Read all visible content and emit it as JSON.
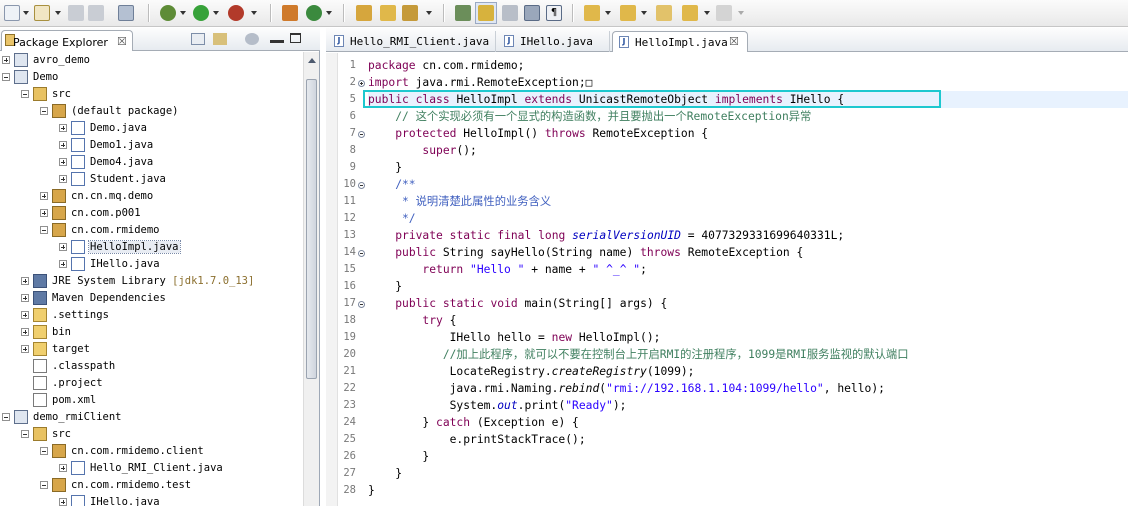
{
  "toolbar": {
    "icons": [
      "new-icon",
      "new-dropdown-icon",
      "save-icon",
      "save-all-icon",
      "print-icon",
      "debug-icon",
      "run-icon",
      "run-external-icon",
      "open-type-icon",
      "new-java-package-icon",
      "open-task-icon",
      "open-folder-icon",
      "search-icon",
      "toggle-mark-occurrences-icon",
      "toggle-highlight-icon",
      "show-whitespace-icon",
      "block-selection-icon",
      "pilcrow-icon",
      "next-annotation-icon",
      "previous-annotation-icon",
      "last-edit-location-icon",
      "back-icon",
      "forward-icon"
    ]
  },
  "package_explorer": {
    "title": "Package Explorer",
    "close_label": "☒",
    "tree": [
      {
        "label": "avro_demo",
        "level": 0,
        "expander": "plus",
        "icon": "java-project-icon"
      },
      {
        "label": "Demo",
        "level": 0,
        "expander": "minus",
        "icon": "java-project-icon"
      },
      {
        "label": "src",
        "level": 1,
        "expander": "minus",
        "icon": "source-folder-icon"
      },
      {
        "label": "(default package)",
        "level": 2,
        "expander": "minus",
        "icon": "package-icon"
      },
      {
        "label": "Demo.java",
        "level": 3,
        "expander": "plus",
        "icon": "java-file-icon"
      },
      {
        "label": "Demo1.java",
        "level": 3,
        "expander": "plus",
        "icon": "java-file-icon"
      },
      {
        "label": "Demo4.java",
        "level": 3,
        "expander": "plus",
        "icon": "java-file-icon"
      },
      {
        "label": "Student.java",
        "level": 3,
        "expander": "plus",
        "icon": "java-file-icon"
      },
      {
        "label": "cn.cn.mq.demo",
        "level": 2,
        "expander": "plus",
        "icon": "package-icon"
      },
      {
        "label": "cn.com.p001",
        "level": 2,
        "expander": "plus",
        "icon": "package-icon"
      },
      {
        "label": "cn.com.rmidemo",
        "level": 2,
        "expander": "minus",
        "icon": "package-icon"
      },
      {
        "label": "HelloImpl.java",
        "level": 3,
        "expander": "plus",
        "icon": "java-file-icon",
        "selected": true
      },
      {
        "label": "IHello.java",
        "level": 3,
        "expander": "plus",
        "icon": "java-file-icon"
      },
      {
        "label": "JRE System Library",
        "suffix": " [jdk1.7.0_13]",
        "level": 1,
        "expander": "plus",
        "icon": "library-icon"
      },
      {
        "label": "Maven Dependencies",
        "level": 1,
        "expander": "plus",
        "icon": "library-icon"
      },
      {
        "label": ".settings",
        "level": 1,
        "expander": "plus",
        "icon": "folder-icon"
      },
      {
        "label": "bin",
        "level": 1,
        "expander": "plus",
        "icon": "folder-icon"
      },
      {
        "label": "target",
        "level": 1,
        "expander": "plus",
        "icon": "folder-icon"
      },
      {
        "label": ".classpath",
        "level": 1,
        "expander": "none",
        "icon": "xml-file-icon"
      },
      {
        "label": ".project",
        "level": 1,
        "expander": "none",
        "icon": "xml-file-icon"
      },
      {
        "label": "pom.xml",
        "level": 1,
        "expander": "none",
        "icon": "maven-file-icon"
      },
      {
        "label": "demo_rmiClient",
        "level": 0,
        "expander": "minus",
        "icon": "java-project-icon"
      },
      {
        "label": "src",
        "level": 1,
        "expander": "minus",
        "icon": "source-folder-icon"
      },
      {
        "label": "cn.com.rmidemo.client",
        "level": 2,
        "expander": "minus",
        "icon": "package-icon"
      },
      {
        "label": "Hello_RMI_Client.java",
        "level": 3,
        "expander": "plus",
        "icon": "java-file-icon"
      },
      {
        "label": "cn.com.rmidemo.test",
        "level": 2,
        "expander": "minus",
        "icon": "package-icon"
      },
      {
        "label": "IHello.java",
        "level": 3,
        "expander": "plus",
        "icon": "java-file-icon"
      }
    ]
  },
  "editor": {
    "tabs": [
      {
        "label": "Hello_RMI_Client.java",
        "active": false
      },
      {
        "label": "IHello.java",
        "active": false
      },
      {
        "label": "HelloImpl.java",
        "active": true
      }
    ],
    "close_label": "☒",
    "lines": [
      {
        "n": "1",
        "text": "package cn.com.rmidemo;"
      },
      {
        "n": "2",
        "fold": "plus",
        "text": "import java.rmi.RemoteException;□"
      },
      {
        "n": "5",
        "text": "public class HelloImpl extends UnicastRemoteObject implements IHello {"
      },
      {
        "n": "6",
        "text": "    // 这个实现必须有一个显式的构造函数，并且要抛出一个RemoteException异常"
      },
      {
        "n": "7",
        "fold": "minus",
        "text": "    protected HelloImpl() throws RemoteException {"
      },
      {
        "n": "8",
        "text": "        super();"
      },
      {
        "n": "9",
        "text": "    }"
      },
      {
        "n": "10",
        "fold": "minus",
        "text": "    /**"
      },
      {
        "n": "11",
        "text": "     * 说明清楚此属性的业务含义"
      },
      {
        "n": "12",
        "text": "     */"
      },
      {
        "n": "13",
        "text": "    private static final long serialVersionUID = 4077329331699640331L;"
      },
      {
        "n": "14",
        "fold": "minus",
        "text": "    public String sayHello(String name) throws RemoteException {"
      },
      {
        "n": "15",
        "text": "        return \"Hello \" + name + \" ^_^ \";"
      },
      {
        "n": "16",
        "text": "    }"
      },
      {
        "n": "17",
        "fold": "minus",
        "text": "    public static void main(String[] args) {"
      },
      {
        "n": "18",
        "text": "        try {"
      },
      {
        "n": "19",
        "text": "            IHello hello = new HelloImpl();"
      },
      {
        "n": "20",
        "text": "           //加上此程序，就可以不要在控制台上开启RMI的注册程序，1099是RMI服务监视的默认端口"
      },
      {
        "n": "21",
        "text": "            LocateRegistry.createRegistry(1099);"
      },
      {
        "n": "22",
        "text": "            java.rmi.Naming.rebind(\"rmi://192.168.1.104:1099/hello\", hello);"
      },
      {
        "n": "23",
        "text": "            System.out.print(\"Ready\");"
      },
      {
        "n": "24",
        "text": "        } catch (Exception e) {"
      },
      {
        "n": "25",
        "text": "            e.printStackTrace();"
      },
      {
        "n": "26",
        "text": "        }"
      },
      {
        "n": "27",
        "text": "    }"
      },
      {
        "n": "28",
        "text": "}"
      }
    ]
  },
  "colors": {
    "keyword": "#7f0055",
    "string": "#2a00ff",
    "comment": "#3f7f5f",
    "javadoc": "#3f5fbf",
    "field": "#0000c0",
    "highlight_box": "#1ec8cf"
  }
}
